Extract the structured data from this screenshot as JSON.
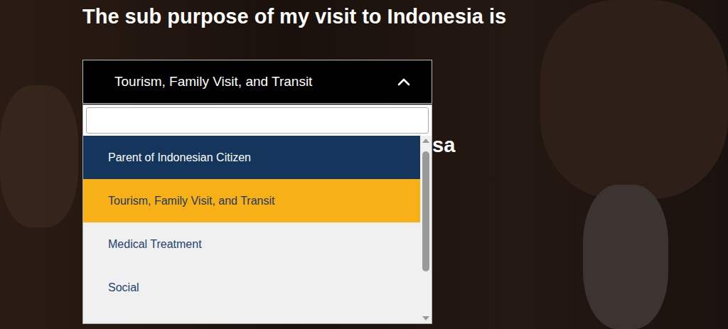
{
  "heading": "The sub purpose of my visit to Indonesia is",
  "dropdown": {
    "value": "Tourism, Family Visit, and Transit",
    "expanded": true,
    "search": {
      "value": ""
    },
    "options": [
      {
        "label": "Parent of Indonesian Citizen",
        "selected": false,
        "highlighted": true
      },
      {
        "label": "Tourism, Family Visit, and Transit",
        "selected": true,
        "highlighted": false
      },
      {
        "label": "Medical Treatment",
        "selected": false,
        "highlighted": false
      },
      {
        "label": "Social",
        "selected": false,
        "highlighted": false
      }
    ],
    "scrollbar": {
      "level": 0.74
    }
  },
  "background_heading": {
    "text": "isa"
  }
}
